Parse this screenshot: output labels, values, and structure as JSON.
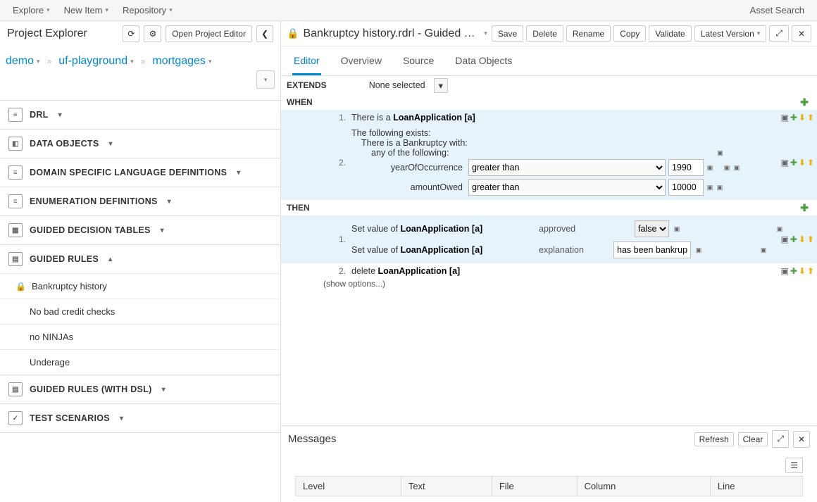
{
  "menubar": {
    "items": [
      "Explore",
      "New Item",
      "Repository"
    ],
    "asset_search": "Asset Search"
  },
  "left": {
    "title": "Project Explorer",
    "open_editor": "Open Project Editor",
    "breadcrumb": [
      "demo",
      "uf-playground",
      "mortgages"
    ],
    "accordion": [
      {
        "label": "DRL",
        "open": false
      },
      {
        "label": "DATA OBJECTS",
        "open": false
      },
      {
        "label": "DOMAIN SPECIFIC LANGUAGE DEFINITIONS",
        "open": false
      },
      {
        "label": "ENUMERATION DEFINITIONS",
        "open": false
      },
      {
        "label": "GUIDED DECISION TABLES",
        "open": false
      },
      {
        "label": "GUIDED RULES",
        "open": true,
        "files": [
          {
            "name": "Bankruptcy history",
            "locked": true
          },
          {
            "name": "No bad credit checks",
            "locked": false
          },
          {
            "name": "no NINJAs",
            "locked": false
          },
          {
            "name": "Underage",
            "locked": false
          }
        ]
      },
      {
        "label": "GUIDED RULES (WITH DSL)",
        "open": false
      },
      {
        "label": "TEST SCENARIOS",
        "open": false
      }
    ]
  },
  "editor": {
    "title": "Bankruptcy history.rdrl - Guided Rules",
    "buttons": [
      "Save",
      "Delete",
      "Rename",
      "Copy",
      "Validate"
    ],
    "version": "Latest Version",
    "tabs": [
      "Editor",
      "Overview",
      "Source",
      "Data Objects"
    ],
    "active_tab": 0,
    "extends_label": "EXTENDS",
    "extends_value": "None selected",
    "when_label": "WHEN",
    "then_label": "THEN",
    "when": [
      {
        "num": "1.",
        "text_prefix": "There is a ",
        "facttype": "LoanApplication",
        "bind": "[a]"
      },
      {
        "num": "2.",
        "lines": [
          "The following exists:",
          "There is a Bankruptcy with:",
          "any of the following:"
        ],
        "constraints": [
          {
            "field": "yearOfOccurrence",
            "op": "greater than",
            "value": "1990"
          },
          {
            "field": "amountOwed",
            "op": "greater than",
            "value": "10000"
          }
        ]
      }
    ],
    "then": [
      {
        "num": "1.",
        "actions": [
          {
            "prefix": "Set value of ",
            "fact": "LoanApplication",
            "bind": "[a]",
            "field": "approved",
            "control": "select",
            "value": "false"
          },
          {
            "prefix": "Set value of ",
            "fact": "LoanApplication",
            "bind": "[a]",
            "field": "explanation",
            "control": "text",
            "value": "has been bankrupt"
          }
        ]
      },
      {
        "num": "2.",
        "delete_prefix": "delete ",
        "delete_fact": "LoanApplication [a]"
      }
    ],
    "show_options": "(show options...)"
  },
  "messages": {
    "title": "Messages",
    "refresh": "Refresh",
    "clear": "Clear",
    "columns": [
      "Level",
      "Text",
      "File",
      "Column",
      "Line"
    ]
  }
}
